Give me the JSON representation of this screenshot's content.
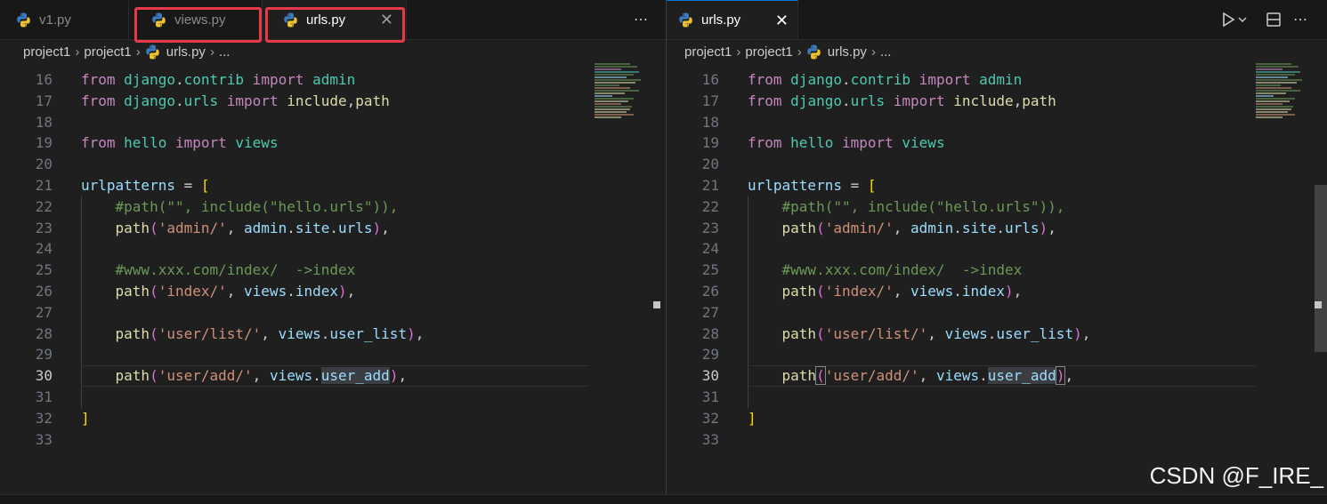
{
  "left_pane": {
    "tabs": [
      {
        "label": "v1.py"
      },
      {
        "label": "views.py"
      },
      {
        "label": "urls.py"
      }
    ],
    "more_actions": "⋯",
    "breadcrumb": {
      "parts": [
        "project1",
        "project1",
        "urls.py",
        "..."
      ]
    }
  },
  "right_pane": {
    "tabs": [
      {
        "label": "urls.py"
      }
    ],
    "breadcrumb": {
      "parts": [
        "project1",
        "project1",
        "urls.py",
        "..."
      ]
    }
  },
  "code_lines": [
    {
      "n": "16",
      "tokens": [
        [
          "from ",
          "kw"
        ],
        [
          "django",
          "mod"
        ],
        [
          ".",
          "p"
        ],
        [
          "contrib",
          "mod"
        ],
        [
          " import ",
          "kw"
        ],
        [
          "admin",
          "mod"
        ]
      ]
    },
    {
      "n": "17",
      "tokens": [
        [
          "from ",
          "kw"
        ],
        [
          "django",
          "mod"
        ],
        [
          ".",
          "p"
        ],
        [
          "urls",
          "mod"
        ],
        [
          " import ",
          "kw"
        ],
        [
          "include",
          "fn"
        ],
        [
          ",",
          "p"
        ],
        [
          "path",
          "fn"
        ]
      ]
    },
    {
      "n": "18",
      "tokens": []
    },
    {
      "n": "19",
      "tokens": [
        [
          "from ",
          "kw"
        ],
        [
          "hello",
          "mod"
        ],
        [
          " import ",
          "kw"
        ],
        [
          "views",
          "mod"
        ]
      ]
    },
    {
      "n": "20",
      "tokens": []
    },
    {
      "n": "21",
      "tokens": [
        [
          "urlpatterns",
          "var"
        ],
        [
          " = ",
          "p"
        ],
        [
          "[",
          "br1"
        ]
      ]
    },
    {
      "n": "22",
      "tokens": [
        [
          "    ",
          "p"
        ],
        [
          "#path(\"\", include(\"hello.urls\")),",
          "cmt"
        ]
      ]
    },
    {
      "n": "23",
      "tokens": [
        [
          "    ",
          "p"
        ],
        [
          "path",
          "fn"
        ],
        [
          "(",
          "br2"
        ],
        [
          "'admin/'",
          "str"
        ],
        [
          ", ",
          "p"
        ],
        [
          "admin",
          "var"
        ],
        [
          ".",
          "p"
        ],
        [
          "site",
          "var"
        ],
        [
          ".",
          "p"
        ],
        [
          "urls",
          "var"
        ],
        [
          ")",
          "br2"
        ],
        [
          ",",
          "p"
        ]
      ]
    },
    {
      "n": "24",
      "tokens": []
    },
    {
      "n": "25",
      "tokens": [
        [
          "    ",
          "p"
        ],
        [
          "#www.xxx.com/index/  ->index",
          "cmt"
        ]
      ]
    },
    {
      "n": "26",
      "tokens": [
        [
          "    ",
          "p"
        ],
        [
          "path",
          "fn"
        ],
        [
          "(",
          "br2"
        ],
        [
          "'index/'",
          "str"
        ],
        [
          ", ",
          "p"
        ],
        [
          "views",
          "var"
        ],
        [
          ".",
          "p"
        ],
        [
          "index",
          "var"
        ],
        [
          ")",
          "br2"
        ],
        [
          ",",
          "p"
        ]
      ]
    },
    {
      "n": "27",
      "tokens": []
    },
    {
      "n": "28",
      "tokens": [
        [
          "    ",
          "p"
        ],
        [
          "path",
          "fn"
        ],
        [
          "(",
          "br2"
        ],
        [
          "'user/list/'",
          "str"
        ],
        [
          ", ",
          "p"
        ],
        [
          "views",
          "var"
        ],
        [
          ".",
          "p"
        ],
        [
          "user_list",
          "var"
        ],
        [
          ")",
          "br2"
        ],
        [
          ",",
          "p"
        ]
      ]
    },
    {
      "n": "29",
      "tokens": []
    },
    {
      "n": "30",
      "tokens": [
        [
          "    ",
          "p"
        ],
        [
          "path",
          "fn"
        ],
        [
          "(",
          "br2"
        ],
        [
          "'user/add/'",
          "str"
        ],
        [
          ", ",
          "p"
        ],
        [
          "views",
          "var"
        ],
        [
          ".",
          "p"
        ],
        [
          "user_add",
          "var sel"
        ],
        [
          ")",
          "br2"
        ],
        [
          ",",
          "p"
        ]
      ]
    },
    {
      "n": "31",
      "tokens": []
    },
    {
      "n": "32",
      "tokens": [
        [
          "]",
          "br1"
        ]
      ]
    },
    {
      "n": "33",
      "tokens": []
    }
  ],
  "current_line": "30",
  "colors": {
    "keyword": "#c586c0",
    "module": "#4ec9b0",
    "function": "#dcdcaa",
    "variable": "#9cdcfe",
    "string": "#ce9178",
    "comment": "#6a9955",
    "highlight_box": "#e8394a"
  },
  "icons": {
    "file_type": "python-icon",
    "run": "play-icon",
    "split": "split-editor-icon",
    "close": "close-icon",
    "more": "more-actions-icon"
  },
  "watermark": "CSDN @F_IRE_"
}
